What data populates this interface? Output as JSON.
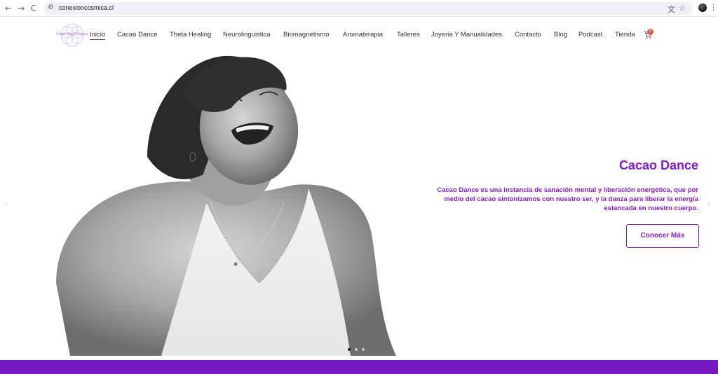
{
  "browser": {
    "url": "conexioncosmica.cl",
    "back_glyph": "←",
    "forward_glyph": "→",
    "reload_glyph": "C",
    "tune_glyph": "⚙",
    "translate_glyph": "文",
    "star_glyph": "☆",
    "menu_glyph": "⋮"
  },
  "logo": {
    "text": "Conexión Cósmica"
  },
  "nav": {
    "items": [
      {
        "label": "Inicio",
        "active": true
      },
      {
        "label": "Cacao Dance"
      },
      {
        "label": "Theta Healing"
      },
      {
        "label": "Neurolinguistica"
      },
      {
        "label": "Biomagnetismo"
      },
      {
        "label": "Aromaterapia"
      },
      {
        "label": "Talleres"
      },
      {
        "label": "Joyeria Y Manualidades"
      },
      {
        "label": "Contacto"
      },
      {
        "label": "Blog"
      },
      {
        "label": "Podcast"
      },
      {
        "label": "Tienda"
      }
    ],
    "cart_count": "0"
  },
  "hero": {
    "title": "Cacao Dance",
    "description": "Cacao Dance es una instancia de sanación mental y liberación energética, que por medio del cacao sintonizamos con nuestro ser, y la danza para liberar la energía estancada en nuestro cuerpo.",
    "cta_label": "Conocer Más",
    "prev_glyph": "‹",
    "next_glyph": "›"
  },
  "colors": {
    "accent": "#8a17e0",
    "footer": "#7418c4",
    "badge": "#e4574a"
  }
}
